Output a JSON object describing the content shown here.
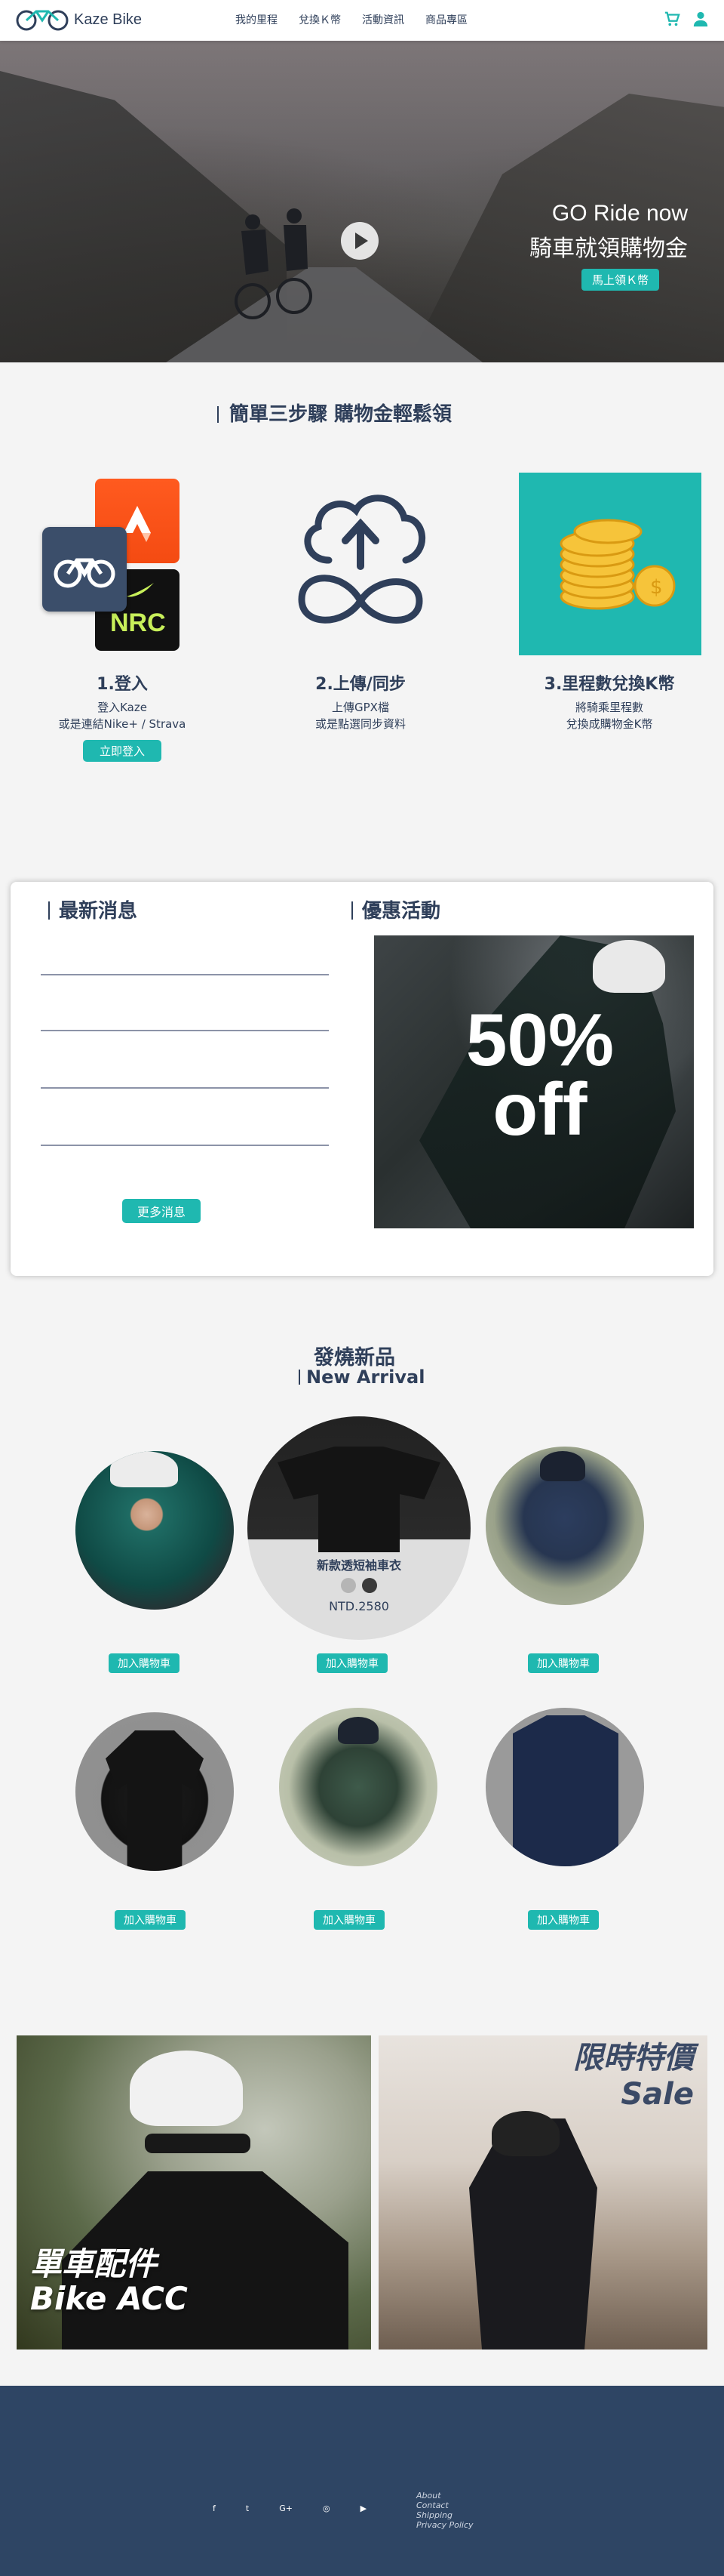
{
  "nav": {
    "logo_text": "Kaze Bike",
    "menu": [
      "我的里程",
      "兌換Ｋ幣",
      "活動資訊",
      "商品專區"
    ],
    "cart_icon": "cart-icon",
    "user_icon": "user-icon"
  },
  "hero": {
    "line1": "GO Ride now",
    "line2": "騎車就領購物金",
    "button": "馬上領Ｋ幣"
  },
  "steps": {
    "title": "簡單三步驟  購物金輕鬆領",
    "items": [
      {
        "heading": "1.登入",
        "desc1": "登入Kaze",
        "desc2": "或是連結Nike+ / Strava",
        "button": "立即登入",
        "nrc": "NRC"
      },
      {
        "heading": "2.上傳/同步",
        "desc1": "上傳GPX檔",
        "desc2": "或是點選同步資料"
      },
      {
        "heading": "3.里程數兌換K幣",
        "desc1": "將騎乘里程數",
        "desc2": "兌換成購物金K幣"
      }
    ]
  },
  "news": {
    "title": "最新消息",
    "more_button": "更多消息"
  },
  "promo": {
    "title": "優惠活動",
    "big_text_1": "50%",
    "big_text_2": "off"
  },
  "arrival": {
    "title": "發燒新品",
    "subtitle": "New Arrival",
    "featured_name": "新款透短袖車衣",
    "featured_price": "NTD.2580",
    "add_label": "加入購物車"
  },
  "banners": {
    "acc_line1": "單車配件",
    "acc_line2": "Bike ACC",
    "sale_line1": "限時特價",
    "sale_line2": "Sale"
  },
  "footer": {
    "social": [
      "f",
      "t",
      "G+",
      "◎",
      "▶"
    ],
    "links": [
      "About",
      "Contact",
      "Shipping",
      "Privacy Policy"
    ]
  },
  "colors": {
    "accent": "#1fb8b0",
    "navy": "#2f3f5a",
    "footer": "#2e4564"
  }
}
